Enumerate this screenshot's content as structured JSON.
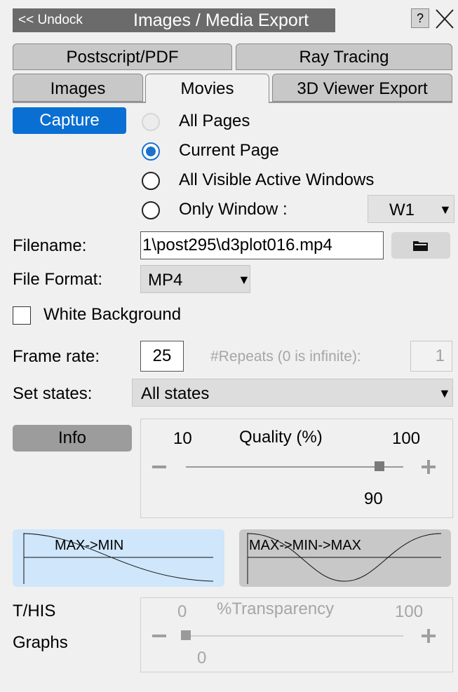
{
  "titlebar": {
    "undock": "<< Undock",
    "title": "Images / Media Export",
    "help": "?"
  },
  "tabs": {
    "row1": [
      "Postscript/PDF",
      "Ray Tracing"
    ],
    "row2": [
      "Images",
      "Movies",
      "3D Viewer Export"
    ],
    "active": "Movies"
  },
  "capture": {
    "button": "Capture",
    "options": [
      "All Pages",
      "Current Page",
      "All Visible Active Windows",
      "Only Window :"
    ],
    "selected": "Current Page",
    "window_value": "W1"
  },
  "filename": {
    "label": "Filename:",
    "value": "1\\post295\\d3plot016.mp4"
  },
  "file_format": {
    "label": "File Format:",
    "value": "MP4"
  },
  "white_background": {
    "label": "White Background",
    "checked": false
  },
  "frame_rate": {
    "label": "Frame rate:",
    "value": "25"
  },
  "repeats": {
    "label": "#Repeats (0 is infinite):",
    "value": "1"
  },
  "set_states": {
    "label": "Set states:",
    "value": "All states"
  },
  "info_button": "Info",
  "quality": {
    "min": "10",
    "title": "Quality (%)",
    "max": "100",
    "value": "90",
    "level": 0.889
  },
  "graphs": {
    "left": "MAX->MIN",
    "right": "MAX->MIN->MAX"
  },
  "this_graphs": {
    "line1": "T/HIS",
    "line2": "Graphs"
  },
  "transparency": {
    "min": "0",
    "title": "%Transparency",
    "max": "100",
    "value": "0",
    "level": 0.0
  },
  "colors": {
    "accent": "#0a6fd2",
    "titlebar": "#6b6b6b",
    "graph_left_bg": "#cfe6fb",
    "graph_right_bg": "#c8c8c8"
  },
  "icons": {
    "browse": "folder-icon",
    "close": "close-icon"
  }
}
